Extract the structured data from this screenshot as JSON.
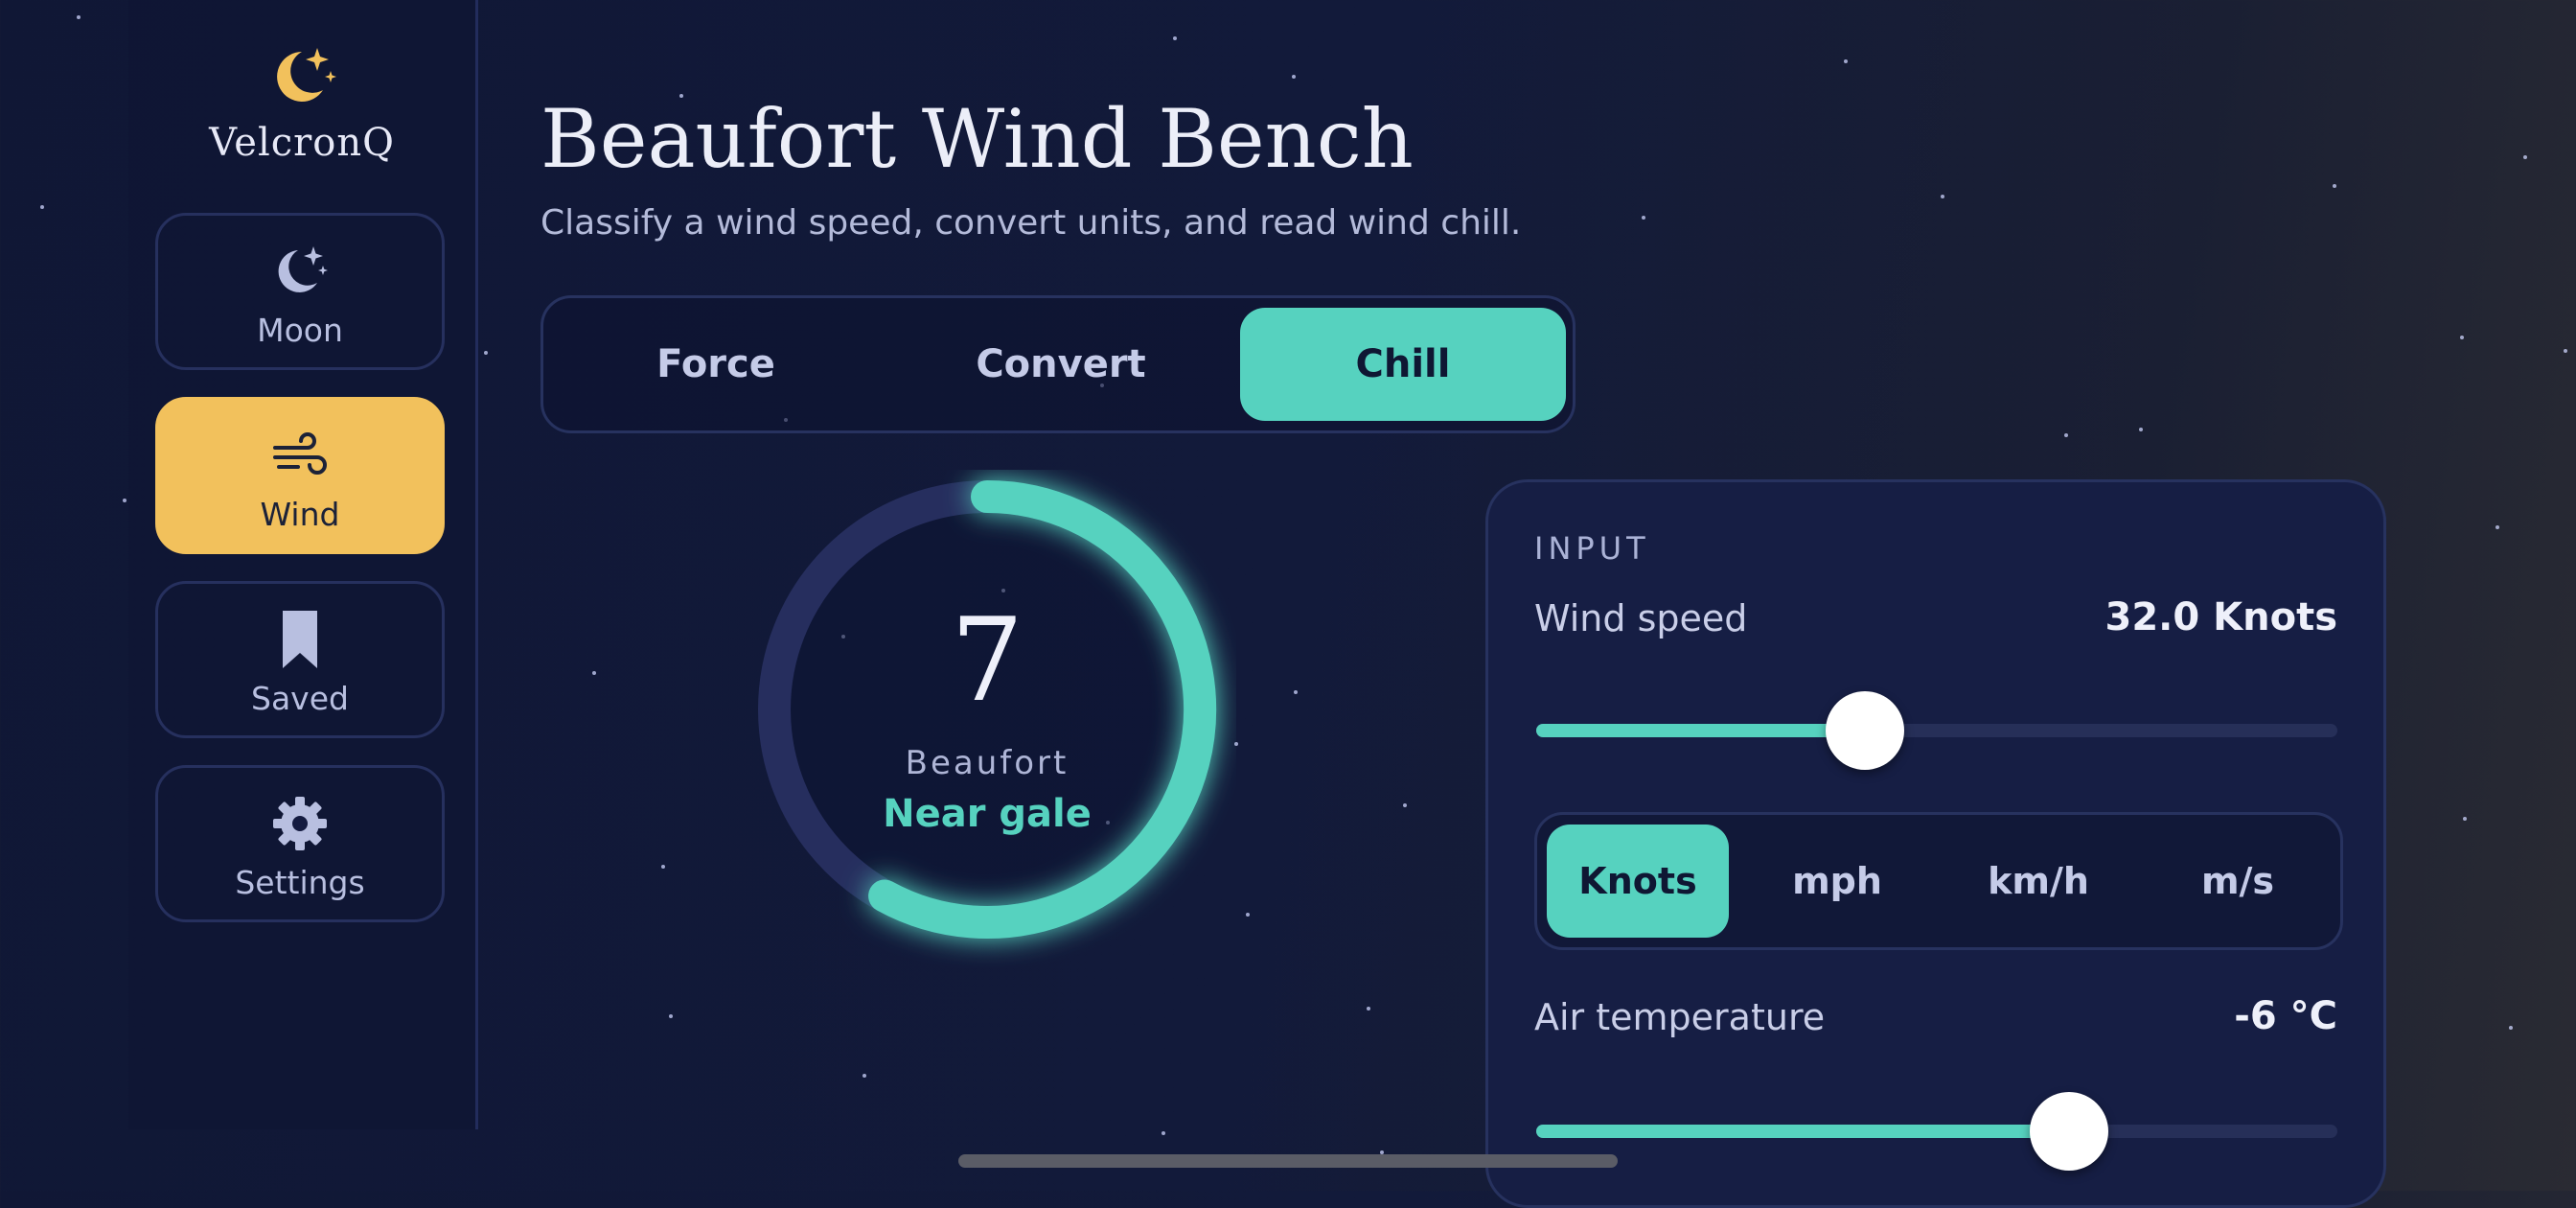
{
  "app": {
    "name": "VelcronQ"
  },
  "sidebar": {
    "items": [
      {
        "label": "Moon",
        "icon": "moon-icon"
      },
      {
        "label": "Wind",
        "icon": "wind-icon",
        "active": true
      },
      {
        "label": "Saved",
        "icon": "bookmark-icon"
      },
      {
        "label": "Settings",
        "icon": "gear-icon"
      }
    ]
  },
  "header": {
    "title": "Beaufort Wind Bench",
    "subtitle": "Classify a wind speed, convert units, and read wind chill."
  },
  "tabs": [
    {
      "label": "Force"
    },
    {
      "label": "Convert"
    },
    {
      "label": "Chill",
      "active": true
    }
  ],
  "gauge": {
    "value": "7",
    "caption": "Beaufort",
    "classification": "Near gale",
    "fraction": 0.58
  },
  "input": {
    "heading": "INPUT",
    "wind_speed": {
      "label": "Wind speed",
      "value": "32.0 Knots",
      "fraction": 0.41
    },
    "units": [
      {
        "label": "Knots",
        "active": true
      },
      {
        "label": "mph"
      },
      {
        "label": "km/h"
      },
      {
        "label": "m/s"
      }
    ],
    "air_temperature": {
      "label": "Air temperature",
      "value": "-6 °C",
      "fraction": 0.665
    }
  },
  "colors": {
    "accent": "#56d2bf",
    "active_nav": "#f2c15c",
    "background": "#121a3a",
    "gauge_track": "#262e5e"
  }
}
